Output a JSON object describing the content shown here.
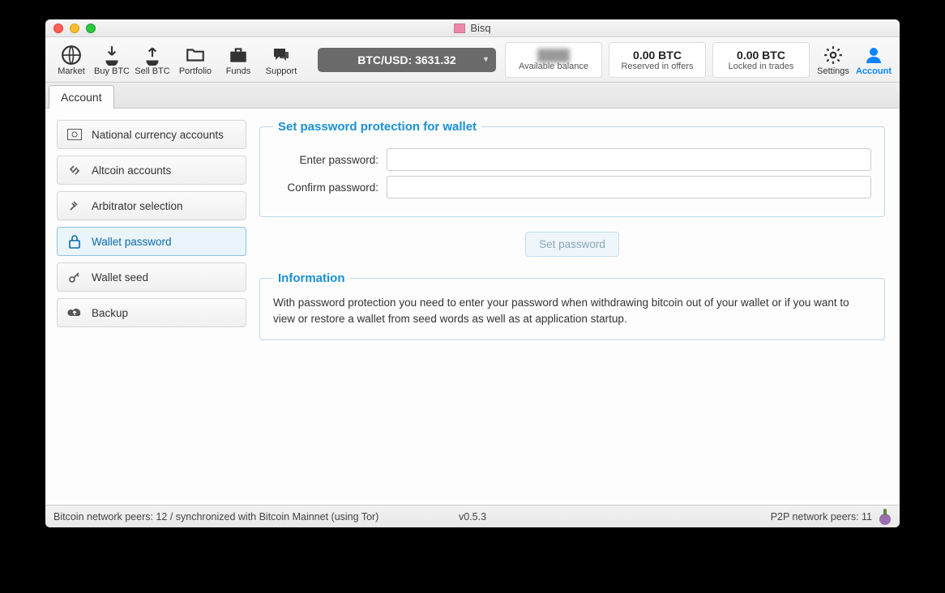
{
  "window": {
    "title": "Bisq"
  },
  "toolbar": {
    "items": [
      {
        "label": "Market"
      },
      {
        "label": "Buy BTC"
      },
      {
        "label": "Sell BTC"
      },
      {
        "label": "Portfolio"
      },
      {
        "label": "Funds"
      },
      {
        "label": "Support"
      }
    ],
    "settings_label": "Settings",
    "account_label": "Account",
    "price": "BTC/USD: 3631.32"
  },
  "balances": {
    "available": {
      "value": "",
      "label": "Available balance"
    },
    "reserved": {
      "value": "0.00 BTC",
      "label": "Reserved in offers"
    },
    "locked": {
      "value": "0.00 BTC",
      "label": "Locked in trades"
    }
  },
  "tab": {
    "label": "Account"
  },
  "sidebar": {
    "items": [
      {
        "label": "National currency accounts"
      },
      {
        "label": "Altcoin accounts"
      },
      {
        "label": "Arbitrator selection"
      },
      {
        "label": "Wallet password"
      },
      {
        "label": "Wallet seed"
      },
      {
        "label": "Backup"
      }
    ]
  },
  "password_section": {
    "legend": "Set password protection for wallet",
    "enter_label": "Enter password:",
    "confirm_label": "Confirm password:",
    "button": "Set password"
  },
  "info_section": {
    "legend": "Information",
    "text": "With password protection you need to enter your password when withdrawing bitcoin out of your wallet or if you want to view or restore a wallet from seed words as well as at application startup."
  },
  "status": {
    "left": "Bitcoin network peers: 12 / synchronized with Bitcoin Mainnet (using Tor)",
    "version": "v0.5.3",
    "right": "P2P network peers: 11"
  }
}
